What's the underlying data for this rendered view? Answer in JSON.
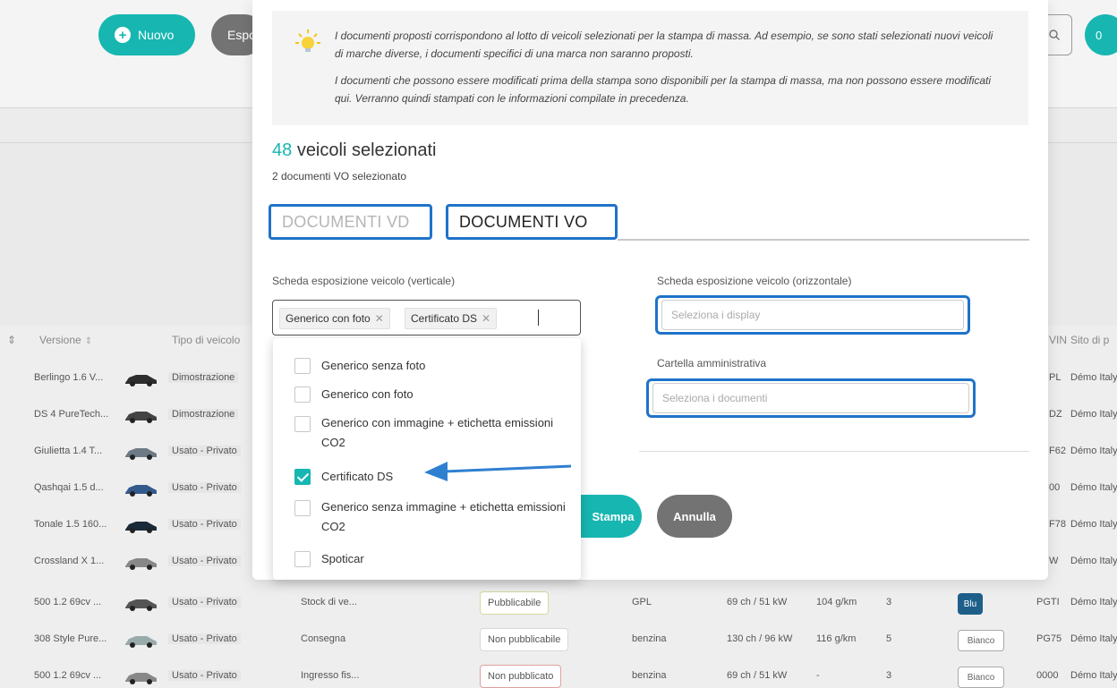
{
  "background": {
    "toolbar": {
      "new_label": "Nuovo",
      "export_label": "Espo",
      "badge": "0"
    },
    "table_headers": {
      "version": "Versione",
      "vehicle_type": "Tipo di veicolo",
      "vin": "VIN",
      "site": "Sito di p"
    },
    "rows": [
      {
        "version": "Berlingo 1.6 V...",
        "type": "Dimostrazione",
        "vin": "PL",
        "site": "Démo Italy"
      },
      {
        "version": "DS 4 PureTech...",
        "type": "Dimostrazione",
        "vin": "DZ",
        "site": "Démo Italy"
      },
      {
        "version": "Giulietta 1.4 T...",
        "type": "Usato - Privato",
        "vin": "F62",
        "site": "Démo Italy"
      },
      {
        "version": "Qashqai 1.5 d...",
        "type": "Usato - Privato",
        "vin": "00",
        "site": "Démo Italy"
      },
      {
        "version": "Tonale 1.5 160...",
        "type": "Usato - Privato",
        "vin": "F78",
        "site": "Démo Italy"
      },
      {
        "version": "Crossland X 1...",
        "type": "Usato - Privato",
        "vin": "W",
        "site": "Démo Italy"
      },
      {
        "version": "500 1.2 69cv ...",
        "type": "Usato - Privato",
        "stock": "Stock di ve...",
        "status": "Pubblicabile",
        "fuel": "GPL",
        "power": "69 ch / 51 kW",
        "co2": "104 g/km",
        "doors": "3",
        "color": "Blu",
        "vin": "PGTI",
        "site": "Démo Italy"
      },
      {
        "version": "308 Style Pure...",
        "type": "Usato - Privato",
        "stock": "Consegna",
        "status": "Non pubblicabile",
        "fuel": "benzina",
        "power": "130 ch / 96 kW",
        "co2": "116 g/km",
        "doors": "5",
        "color": "Bianco",
        "vin": "PG75",
        "site": "Démo Italy"
      },
      {
        "version": "500 1.2 69cv ...",
        "type": "Usato - Privato",
        "stock": "Ingresso fis...",
        "status": "Non pubblicato",
        "fuel": "benzina",
        "power": "69 ch / 51 kW",
        "co2": "-",
        "doors": "3",
        "color": "Bianco",
        "vin": "0000",
        "site": "Démo Italy"
      }
    ]
  },
  "modal": {
    "info": {
      "p1": "I documenti proposti corrispondono al lotto di veicoli selezionati per la stampa di massa. Ad esempio, se sono stati selezionati nuovi veicoli di marche diverse, i documenti specifici di una marca non saranno proposti.",
      "p2": "I documenti che possono essere modificati prima della stampa sono disponibili per la stampa di massa, ma non possono essere modificati qui. Verranno quindi stampati con le informazioni compilate in precedenza."
    },
    "selected_count": "48",
    "selected_label": "veicoli selezionati",
    "docs_selected": "2 documenti VO selezionato",
    "tabs": {
      "vd": "DOCUMENTI VD",
      "vo": "DOCUMENTI VO"
    },
    "field_vertical_label": "Scheda esposizione veicolo (verticale)",
    "chips": [
      "Generico con foto",
      "Certificato DS"
    ],
    "field_horizontal_label": "Scheda esposizione veicolo (orizzontale)",
    "field_horizontal_placeholder": "Seleziona i display",
    "field_admin_label": "Cartella amministrativa",
    "field_admin_placeholder": "Seleziona i documenti",
    "print_label": "Stampa",
    "cancel_label": "Annulla"
  },
  "dropdown": {
    "options": [
      {
        "label": "Generico senza foto",
        "checked": false
      },
      {
        "label": "Generico con foto",
        "checked": false
      },
      {
        "label": "Generico con immagine + etichetta emissioni CO2",
        "checked": false
      },
      {
        "label": "Certificato DS",
        "checked": true
      },
      {
        "label": "Generico senza immagine + etichetta emissioni CO2",
        "checked": false
      },
      {
        "label": "Spoticar",
        "checked": false
      }
    ]
  },
  "colors": {
    "accent": "#17b6b1",
    "highlight": "#1f73c9",
    "neutral_button": "#737373"
  }
}
